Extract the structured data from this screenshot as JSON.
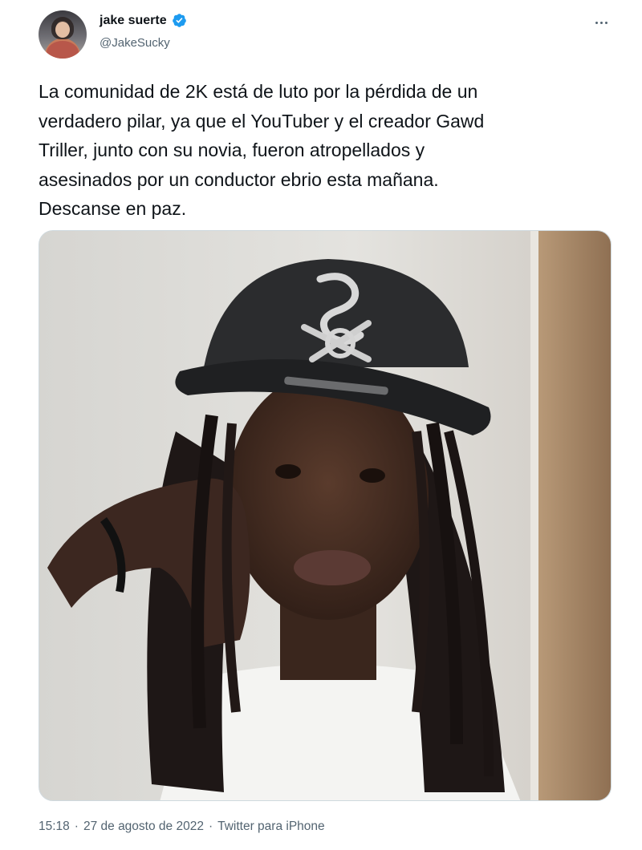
{
  "tweet": {
    "author": {
      "display_name": "jake suerte",
      "handle": "@JakeSucky",
      "verified": true,
      "avatar_icon": "profile-avatar"
    },
    "more_icon": "more-horizontal-icon",
    "text": "La comunidad de 2K está de luto por la pérdida de un\nverdadero pilar, ya que el YouTuber y el creador Gawd\nTriller, junto con su novia, fueron atropellados y\nasesinados por un conductor ebrio esta mañana.\nDescanse en paz.",
    "media": {
      "type": "photo",
      "cap_logo_icon": "sox-logo-icon"
    },
    "meta": {
      "time": "15:18",
      "separator": "·",
      "date": "27 de agosto de 2022",
      "source": "Twitter para iPhone"
    }
  },
  "colors": {
    "verified_blue": "#1d9bf0",
    "text_primary": "#0f1419",
    "text_secondary": "#536471",
    "border": "#cfd9de"
  }
}
